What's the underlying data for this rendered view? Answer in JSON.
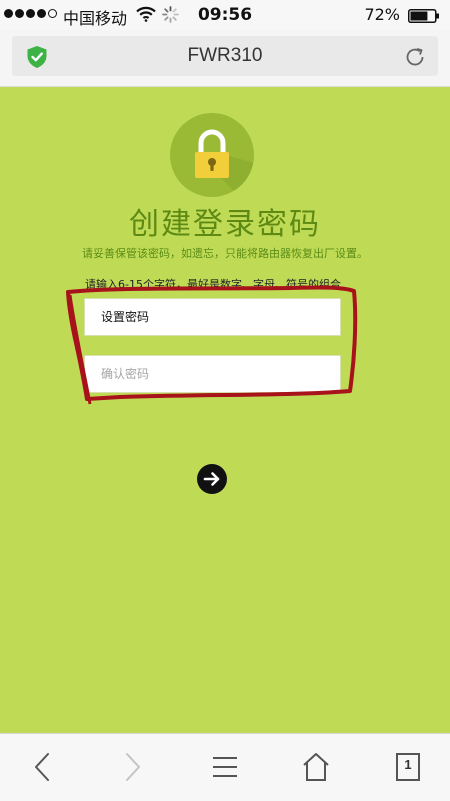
{
  "status_bar": {
    "carrier": "中国移动",
    "time": "09:56",
    "battery_percent": "72%",
    "battery_level": 0.72,
    "signal_bars": 4,
    "signal_max": 5
  },
  "browser": {
    "page_title": "FWR310"
  },
  "setup": {
    "title": "创建登录密码",
    "subtitle": "请妥善保管该密码，如遗忘，只能将路由器恢复出厂设置。",
    "hint": "请输入6-15个字符，最好是数字、字母、符号的组合",
    "password_placeholder": "设置密码",
    "confirm_placeholder": "确认密码"
  },
  "toolbar": {
    "tab_count": "1"
  },
  "colors": {
    "page_background": "#bfdb56",
    "accent_dark_green": "#5e8a14",
    "lock_yellow": "#f2cf3a",
    "annotation_red": "#a8121a"
  },
  "icons": {
    "status": [
      "signal-icon",
      "wifi-icon",
      "loading-spinner-icon",
      "battery-icon"
    ],
    "address_bar": [
      "shield-check-icon",
      "reload-icon"
    ],
    "page": [
      "lock-icon",
      "arrow-right-icon"
    ],
    "toolbar": [
      "back-arrow-icon",
      "forward-arrow-icon",
      "menu-icon",
      "home-icon",
      "tabs-icon"
    ]
  }
}
